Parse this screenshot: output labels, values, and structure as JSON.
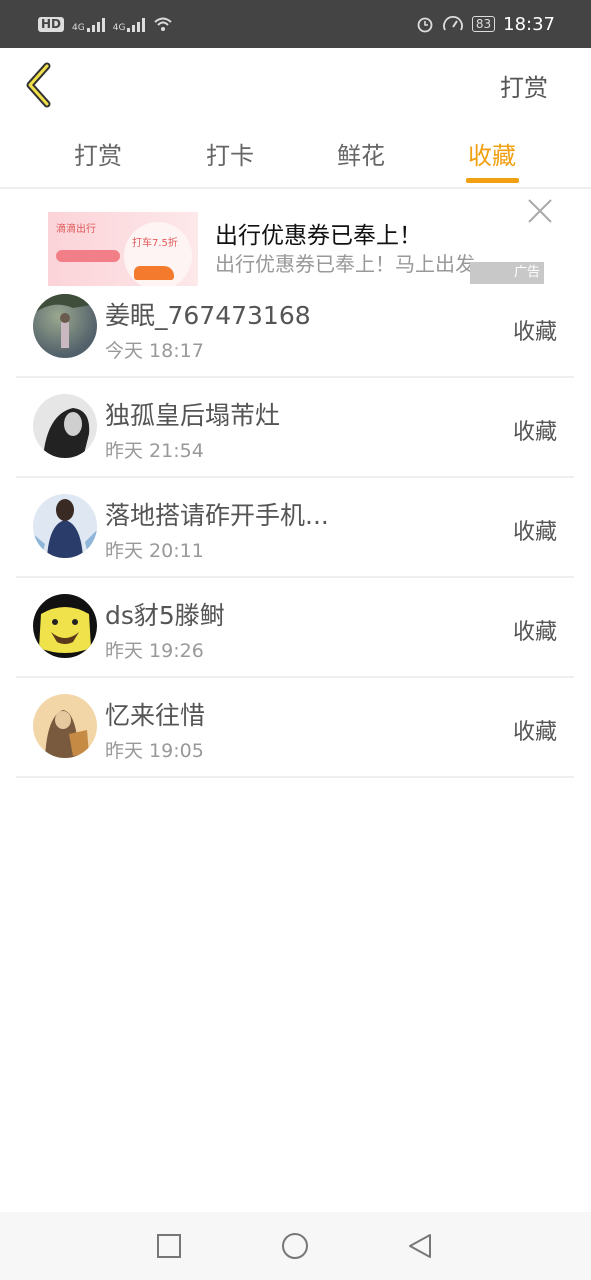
{
  "status_bar": {
    "hd": "HD",
    "net1": "4G",
    "net2": "4G",
    "battery": "83",
    "time": "18:37"
  },
  "nav": {
    "right_action": "打赏"
  },
  "tabs": [
    {
      "label": "打赏"
    },
    {
      "label": "打卡"
    },
    {
      "label": "鲜花"
    },
    {
      "label": "收藏"
    }
  ],
  "active_tab": "收藏",
  "accent_color": "#f0a010",
  "ad": {
    "brand": "滴滴出行",
    "banner_text": "打车7.5折",
    "title": "出行优惠券已奉上！",
    "description": "出行优惠券已奉上！马上出发",
    "label": "广告"
  },
  "list": [
    {
      "name": "姜眠_767473168",
      "time": "今天 18:17",
      "action": "收藏"
    },
    {
      "name": "独孤皇后塌芾灶",
      "time": "昨天 21:54",
      "action": "收藏"
    },
    {
      "name": "落地搭请砟开手机...",
      "time": "昨天 20:11",
      "action": "收藏"
    },
    {
      "name": "ds豺5滕鲥",
      "time": "昨天 19:26",
      "action": "收藏"
    },
    {
      "name": "忆来往惜",
      "time": "昨天 19:05",
      "action": "收藏"
    }
  ]
}
